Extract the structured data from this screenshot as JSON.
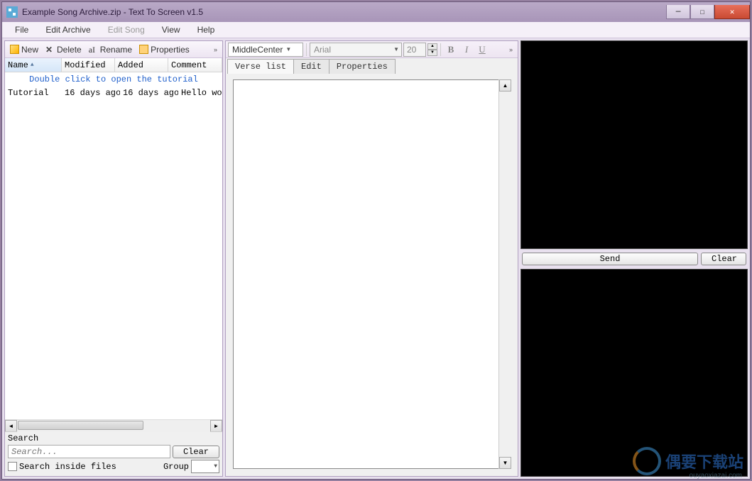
{
  "window": {
    "title": "Example Song Archive.zip - Text To Screen v1.5"
  },
  "menu": {
    "file": "File",
    "edit_archive": "Edit Archive",
    "edit_song": "Edit Song",
    "view": "View",
    "help": "Help"
  },
  "left_toolbar": {
    "new": "New",
    "delete": "Delete",
    "rename": "Rename",
    "properties": "Properties"
  },
  "list": {
    "headers": {
      "name": "Name",
      "modified": "Modified",
      "added": "Added",
      "comment": "Comment"
    },
    "hint": "Double click to open the tutorial",
    "rows": [
      {
        "name": "Tutorial",
        "modified": "16 days ago",
        "added": "16 days ago",
        "comment": "Hello wor"
      }
    ]
  },
  "search": {
    "label": "Search",
    "placeholder": "Search...",
    "clear": "Clear",
    "inside": "Search inside files",
    "group": "Group"
  },
  "format": {
    "align": "MiddleCenter",
    "font": "Arial",
    "size": "20",
    "bold": "B",
    "italic": "I",
    "underline": "U"
  },
  "mid_tabs": {
    "verse_list": "Verse list",
    "edit": "Edit",
    "properties": "Properties"
  },
  "right": {
    "send": "Send",
    "clear": "Clear"
  },
  "watermark": {
    "text": "偶要下载站",
    "sub": "ouyaoxiazai.com"
  }
}
